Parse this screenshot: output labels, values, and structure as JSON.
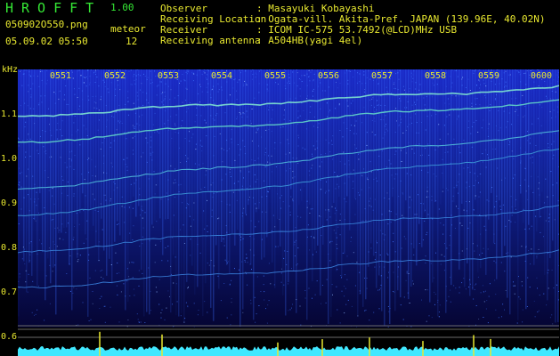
{
  "header": {
    "app_name": "HROFFT",
    "app_version": "1.00",
    "filename": "050902O550.png",
    "datetime": "05.09.02 05:50",
    "meteor_label": "meteor",
    "meteor_count": "12",
    "info": [
      {
        "key": "Observer",
        "sep": ":",
        "value": "Masayuki Kobayashi"
      },
      {
        "key": "Receiving Location",
        "sep": ":",
        "value": "Ogata-vill. Akita-Pref. JAPAN (139.96E, 40.02N)"
      },
      {
        "key": "Receiver",
        "sep": ":",
        "value": "ICOM IC-575 53.7492(@LCD)MHz USB"
      },
      {
        "key": "Receiving antenna",
        "sep": ":",
        "value": "A504HB(yagi 4el)"
      }
    ]
  },
  "axis": {
    "y_unit": "kHz",
    "y_ticks": [
      "1.1",
      "1.0",
      "0.9",
      "0.8",
      "0.7",
      "0.6"
    ],
    "time_ticks": [
      "0551",
      "0552",
      "0553",
      "0554",
      "0555",
      "0556",
      "0557",
      "0558",
      "0559",
      "0600"
    ]
  },
  "colors": {
    "text": "#e8e830",
    "title": "#35e835",
    "background": "#050533",
    "trace": "#7fe6cf",
    "strip": "#40e8ff"
  }
}
